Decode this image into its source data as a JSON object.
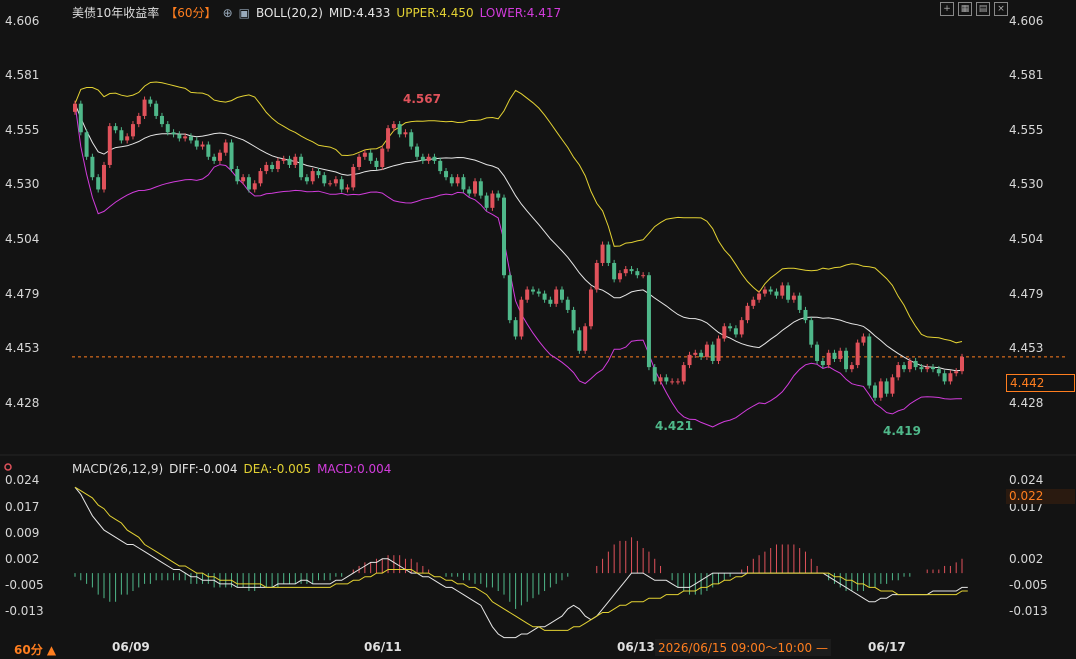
{
  "header": {
    "title": "美债10年收益率",
    "period": "【60分】",
    "indicator": "BOLL(20,2)",
    "mid": "MID:4.433",
    "upper": "UPPER:4.450",
    "lower": "LOWER:4.417"
  },
  "macd_header": {
    "name": "MACD(26,12,9)",
    "diff": "DIFF:-0.004",
    "dea": "DEA:-0.005",
    "macd": "MACD:0.004"
  },
  "price_axis": [
    "4.606",
    "4.581",
    "4.555",
    "4.530",
    "4.504",
    "4.479",
    "4.453",
    "4.428"
  ],
  "macd_axis": [
    "0.024",
    "0.017",
    "0.009",
    "0.002",
    "-0.005",
    "-0.013"
  ],
  "current_price": "4.442",
  "current_macd": "0.022",
  "dates": [
    "06/09",
    "06/11",
    "06/13",
    "06/17"
  ],
  "period_button": "60分 ▲",
  "tooltip_time": "2026/06/15 09:00～10:00 —",
  "annotations": {
    "high": "4.567",
    "low1": "4.421",
    "low2": "4.419"
  },
  "colors": {
    "up": "#e0525b",
    "down": "#4fb88a",
    "mid": "#e6e6e6",
    "upper": "#e3d233",
    "lower": "#d23cdc",
    "accent": "#ff7e1f"
  },
  "chart_data": [
    {
      "type": "candlestick",
      "title": "美债10年收益率",
      "ylim": [
        4.416,
        4.606
      ],
      "closes": [
        4.566,
        4.552,
        4.54,
        4.53,
        4.524,
        4.536,
        4.555,
        4.553,
        4.548,
        4.55,
        4.556,
        4.56,
        4.568,
        4.566,
        4.56,
        4.556,
        4.552,
        4.551,
        4.549,
        4.55,
        4.548,
        4.545,
        4.546,
        4.54,
        4.538,
        4.542,
        4.547,
        4.534,
        4.528,
        4.53,
        4.524,
        4.527,
        4.533,
        4.536,
        4.534,
        4.538,
        4.539,
        4.536,
        4.54,
        4.53,
        4.528,
        4.533,
        4.531,
        4.527,
        4.527,
        4.529,
        4.524,
        4.525,
        4.535,
        4.54,
        4.542,
        4.538,
        4.535,
        4.544,
        4.554,
        4.556,
        4.551,
        4.552,
        4.545,
        4.54,
        4.538,
        4.54,
        4.538,
        4.533,
        4.53,
        4.527,
        4.53,
        4.524,
        4.522,
        4.528,
        4.521,
        4.515,
        4.522,
        4.52,
        4.482,
        4.46,
        4.452,
        4.47,
        4.475,
        4.474,
        4.473,
        4.47,
        4.468,
        4.475,
        4.47,
        4.465,
        4.455,
        4.445,
        4.457,
        4.475,
        4.488,
        4.497,
        4.488,
        4.48,
        4.483,
        4.485,
        4.484,
        4.482,
        4.482,
        4.437,
        4.43,
        4.432,
        4.43,
        4.43,
        4.43,
        4.438,
        4.443,
        4.444,
        4.442,
        4.448,
        4.44,
        4.451,
        4.457,
        4.456,
        4.453,
        4.46,
        4.467,
        4.47,
        4.473,
        4.475,
        4.474,
        4.472,
        4.477,
        4.47,
        4.472,
        4.465,
        4.46,
        4.448,
        4.44,
        4.438,
        4.444,
        4.441,
        4.445,
        4.436,
        4.438,
        4.449,
        4.452,
        4.428,
        4.422,
        4.43,
        4.424,
        4.432,
        4.438,
        4.436,
        4.44,
        4.437,
        4.436,
        4.437,
        4.436,
        4.434,
        4.43,
        4.434,
        4.435,
        4.442
      ]
    },
    {
      "type": "bar",
      "title": "MACD(26,12,9)",
      "ylim": [
        -0.017,
        0.026
      ],
      "series": [
        {
          "name": "MACD",
          "values": [
            -0.001,
            -0.002,
            -0.003,
            -0.004,
            -0.006,
            -0.007,
            -0.008,
            -0.008,
            -0.006,
            -0.006,
            -0.005,
            -0.004,
            -0.003,
            -0.003,
            -0.002,
            -0.002,
            -0.002,
            -0.002,
            -0.002,
            -0.002,
            -0.003,
            -0.003,
            -0.003,
            -0.003,
            -0.004,
            -0.004,
            -0.004,
            -0.004,
            -0.004,
            -0.004,
            -0.005,
            -0.005,
            -0.004,
            -0.004,
            -0.004,
            -0.004,
            -0.003,
            -0.003,
            -0.003,
            -0.003,
            -0.003,
            -0.003,
            -0.002,
            -0.002,
            -0.002,
            -0.001,
            -0.001,
            0.0,
            0.001,
            0.002,
            0.003,
            0.003,
            0.004,
            0.004,
            0.005,
            0.005,
            0.005,
            0.004,
            0.004,
            0.003,
            0.002,
            0.001,
            0.0,
            0.0,
            -0.001,
            -0.001,
            -0.001,
            -0.002,
            -0.002,
            -0.003,
            -0.003,
            -0.004,
            -0.004,
            -0.005,
            -0.006,
            -0.008,
            -0.01,
            -0.009,
            -0.008,
            -0.007,
            -0.006,
            -0.005,
            -0.004,
            -0.003,
            -0.002,
            -0.001,
            0.0,
            0.0,
            0.0,
            0.0,
            0.002,
            0.004,
            0.006,
            0.008,
            0.009,
            0.009,
            0.01,
            0.009,
            0.007,
            0.006,
            0.004,
            0.002,
            0.0,
            -0.002,
            -0.004,
            -0.005,
            -0.006,
            -0.006,
            -0.006,
            -0.005,
            -0.004,
            -0.003,
            -0.002,
            -0.001,
            0.0,
            0.001,
            0.002,
            0.004,
            0.005,
            0.006,
            0.007,
            0.008,
            0.008,
            0.008,
            0.008,
            0.007,
            0.006,
            0.004,
            0.002,
            0.0,
            -0.002,
            -0.003,
            -0.004,
            -0.005,
            -0.005,
            -0.005,
            -0.005,
            -0.004,
            -0.004,
            -0.003,
            -0.003,
            -0.002,
            -0.002,
            -0.001,
            -0.001,
            0.0,
            0.0,
            0.001,
            0.001,
            0.001,
            0.002,
            0.002,
            0.003,
            0.004
          ]
        },
        {
          "name": "DIFF",
          "values": [
            0.024,
            0.022,
            0.019,
            0.016,
            0.014,
            0.012,
            0.011,
            0.01,
            0.009,
            0.008,
            0.008,
            0.007,
            0.006,
            0.005,
            0.004,
            0.003,
            0.002,
            0.001,
            0.001,
            0.0,
            -0.001,
            -0.001,
            -0.002,
            -0.002,
            -0.002,
            -0.003,
            -0.003,
            -0.003,
            -0.004,
            -0.004,
            -0.004,
            -0.004,
            -0.004,
            -0.004,
            -0.004,
            -0.003,
            -0.003,
            -0.003,
            -0.003,
            -0.002,
            -0.002,
            -0.003,
            -0.003,
            -0.003,
            -0.003,
            -0.002,
            -0.002,
            -0.001,
            0.0,
            0.001,
            0.002,
            0.003,
            0.003,
            0.004,
            0.004,
            0.003,
            0.002,
            0.001,
            0.0,
            0.0,
            -0.001,
            -0.001,
            -0.002,
            -0.003,
            -0.004,
            -0.004,
            -0.005,
            -0.006,
            -0.007,
            -0.008,
            -0.009,
            -0.012,
            -0.015,
            -0.017,
            -0.018,
            -0.018,
            -0.018,
            -0.017,
            -0.017,
            -0.016,
            -0.015,
            -0.015,
            -0.014,
            -0.013,
            -0.012,
            -0.01,
            -0.009,
            -0.01,
            -0.012,
            -0.013,
            -0.012,
            -0.01,
            -0.008,
            -0.006,
            -0.004,
            -0.002,
            0.0,
            0.0,
            0.0,
            -0.001,
            -0.002,
            -0.002,
            -0.002,
            -0.003,
            -0.004,
            -0.004,
            -0.004,
            -0.003,
            -0.002,
            -0.001,
            0.0,
            0.0,
            0.0,
            0.0,
            0.0,
            0.0,
            0.0,
            0.0,
            0.0,
            0.0,
            0.0,
            0.0,
            0.0,
            0.0,
            0.0,
            0.0,
            0.0,
            0.0,
            0.0,
            0.0,
            -0.001,
            -0.002,
            -0.003,
            -0.004,
            -0.005,
            -0.006,
            -0.007,
            -0.008,
            -0.008,
            -0.007,
            -0.007,
            -0.006,
            -0.006,
            -0.006,
            -0.006,
            -0.006,
            -0.006,
            -0.006,
            -0.005,
            -0.005,
            -0.005,
            -0.005,
            -0.005,
            -0.004,
            -0.004
          ]
        },
        {
          "name": "DEA",
          "values": [
            0.024,
            0.023,
            0.022,
            0.021,
            0.019,
            0.018,
            0.016,
            0.015,
            0.014,
            0.012,
            0.011,
            0.01,
            0.008,
            0.007,
            0.006,
            0.005,
            0.004,
            0.003,
            0.002,
            0.002,
            0.001,
            0.0,
            0.0,
            -0.001,
            -0.001,
            -0.002,
            -0.002,
            -0.002,
            -0.003,
            -0.003,
            -0.003,
            -0.003,
            -0.003,
            -0.004,
            -0.004,
            -0.004,
            -0.004,
            -0.004,
            -0.004,
            -0.004,
            -0.004,
            -0.004,
            -0.004,
            -0.004,
            -0.004,
            -0.003,
            -0.003,
            -0.003,
            -0.002,
            -0.002,
            -0.001,
            -0.001,
            0.0,
            0.0,
            0.001,
            0.001,
            0.001,
            0.001,
            0.001,
            0.0,
            0.0,
            0.0,
            -0.001,
            -0.001,
            -0.002,
            -0.002,
            -0.003,
            -0.003,
            -0.004,
            -0.004,
            -0.005,
            -0.006,
            -0.008,
            -0.009,
            -0.01,
            -0.011,
            -0.012,
            -0.013,
            -0.014,
            -0.015,
            -0.015,
            -0.016,
            -0.016,
            -0.016,
            -0.016,
            -0.016,
            -0.015,
            -0.015,
            -0.014,
            -0.013,
            -0.012,
            -0.011,
            -0.011,
            -0.01,
            -0.009,
            -0.009,
            -0.008,
            -0.008,
            -0.008,
            -0.007,
            -0.007,
            -0.007,
            -0.006,
            -0.006,
            -0.006,
            -0.005,
            -0.005,
            -0.005,
            -0.004,
            -0.004,
            -0.003,
            -0.003,
            -0.002,
            -0.002,
            -0.001,
            -0.001,
            0.0,
            0.0,
            0.0,
            0.0,
            0.0,
            0.0,
            0.0,
            0.0,
            0.0,
            0.0,
            0.0,
            0.0,
            0.0,
            0.0,
            0.0,
            -0.001,
            -0.001,
            -0.002,
            -0.002,
            -0.003,
            -0.003,
            -0.004,
            -0.004,
            -0.005,
            -0.005,
            -0.005,
            -0.006,
            -0.006,
            -0.006,
            -0.006,
            -0.006,
            -0.006,
            -0.006,
            -0.006,
            -0.006,
            -0.006,
            -0.006,
            -0.005,
            -0.005
          ]
        }
      ]
    }
  ]
}
